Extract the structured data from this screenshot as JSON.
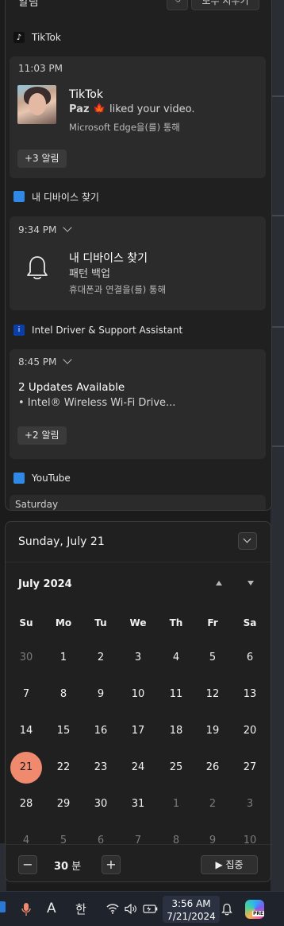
{
  "notification_center": {
    "title": "알림",
    "clear_all_label": "모두 지우기",
    "groups": [
      {
        "app": "TikTok",
        "time": "11:03 PM",
        "title": "TikTok",
        "sender": "Paz 🍁",
        "message": "liked your video.",
        "via": "Microsoft Edge을(를) 통해",
        "more": "+3 알림"
      },
      {
        "app": "내 디바이스 찾기",
        "time": "9:34 PM",
        "title": "내 디바이스 찾기",
        "line": "패턴 백업",
        "via": "휴대폰과 연결을(를) 통해"
      },
      {
        "app": "Intel Driver & Support Assistant",
        "time": "8:45 PM",
        "title": "2 Updates Available",
        "line": "• Intel® Wireless Wi-Fi Drive...",
        "more": "+2 알림"
      },
      {
        "app": "YouTube",
        "time": "Saturday"
      }
    ]
  },
  "calendar": {
    "selected_date": "Sunday, July 21",
    "month_label": "July 2024",
    "weekdays": [
      "Su",
      "Mo",
      "Tu",
      "We",
      "Th",
      "Fr",
      "Sa"
    ],
    "weeks": [
      [
        "30",
        "1",
        "2",
        "3",
        "4",
        "5",
        "6"
      ],
      [
        "7",
        "8",
        "9",
        "10",
        "11",
        "12",
        "13"
      ],
      [
        "14",
        "15",
        "16",
        "17",
        "18",
        "19",
        "20"
      ],
      [
        "21",
        "22",
        "23",
        "24",
        "25",
        "26",
        "27"
      ],
      [
        "28",
        "29",
        "30",
        "31",
        "1",
        "2",
        "3"
      ],
      [
        "4",
        "5",
        "6",
        "7",
        "8",
        "9",
        "10"
      ]
    ],
    "today": "21",
    "today_color": "#f08a6e",
    "focus": {
      "decrease": "−",
      "increase": "+",
      "minutes_value": "30",
      "minutes_unit": "분",
      "focus_label": "▶ 집중"
    }
  },
  "taskbar": {
    "ime_letter": "A",
    "ime_language": "한",
    "time": "3:56 AM",
    "date": "7/21/2024",
    "copilot_badge": "PRE"
  },
  "icons": [
    "tiktok-icon",
    "find-my-device-icon",
    "intel-icon",
    "youtube-icon",
    "bell-icon",
    "microphone-icon",
    "wifi-icon",
    "volume-icon",
    "battery-icon",
    "notification-bell-icon",
    "copilot-icon"
  ]
}
